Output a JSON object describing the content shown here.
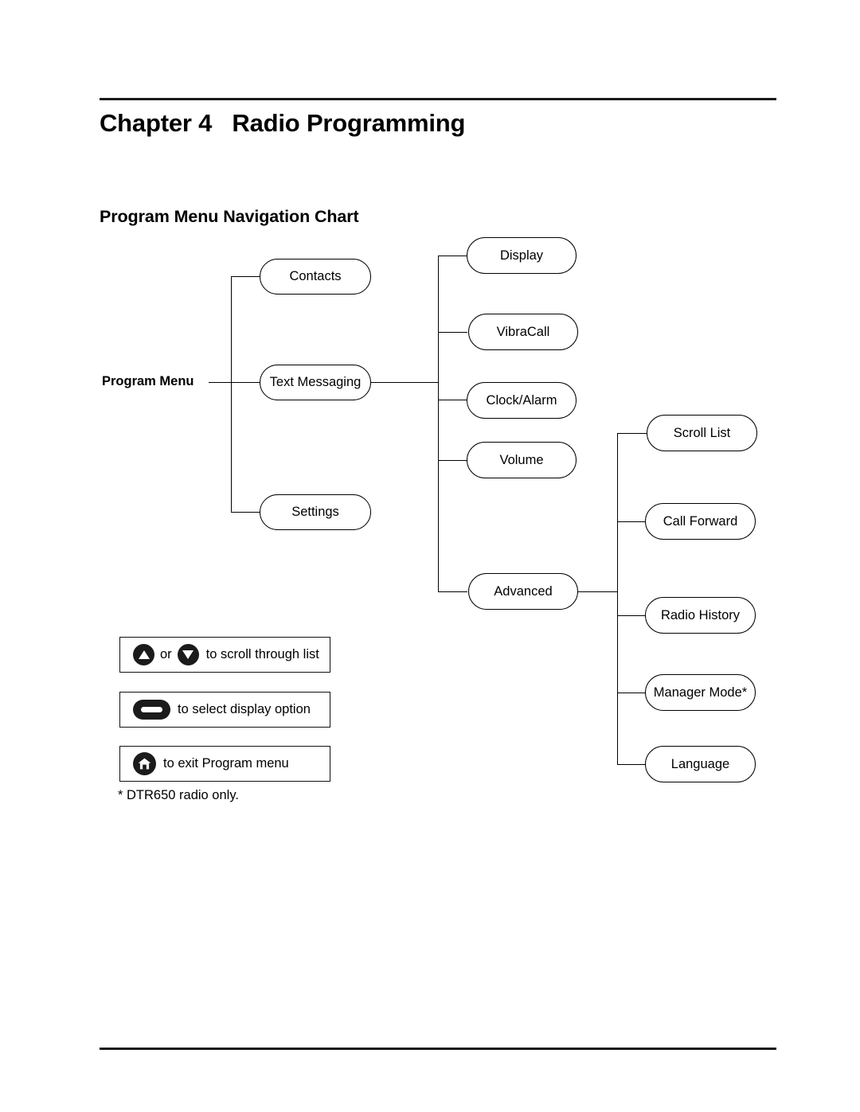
{
  "page": {
    "chapter_title": "Chapter 4   Radio Programming",
    "section_title": "Program Menu Navigation Chart",
    "footnote": "* DTR650 radio only."
  },
  "diagram": {
    "root_label": "Program Menu",
    "level1": [
      {
        "label": "Contacts"
      },
      {
        "label": "Text Messaging"
      },
      {
        "label": "Settings"
      }
    ],
    "level2": [
      {
        "label": "Display"
      },
      {
        "label": "VibraCall"
      },
      {
        "label": "Clock/Alarm"
      },
      {
        "label": "Volume"
      },
      {
        "label": "Advanced"
      }
    ],
    "level3": [
      {
        "label": "Scroll List"
      },
      {
        "label": "Call Forward"
      },
      {
        "label": "Radio History"
      },
      {
        "label": "Manager Mode*"
      },
      {
        "label": "Language"
      }
    ]
  },
  "legend": [
    {
      "icon_up": "triangle-up-button-icon",
      "conjunction": "or",
      "icon_down": "triangle-down-button-icon",
      "text": "to scroll through list"
    },
    {
      "icon": "select-pill-button-icon",
      "text": "to select display option"
    },
    {
      "icon": "home-button-icon",
      "text": "to exit Program menu"
    }
  ],
  "colors": {
    "rule": "#1a1a1a",
    "node_border": "#000000",
    "button_fill": "#1b1b1b",
    "text": "#000000"
  }
}
